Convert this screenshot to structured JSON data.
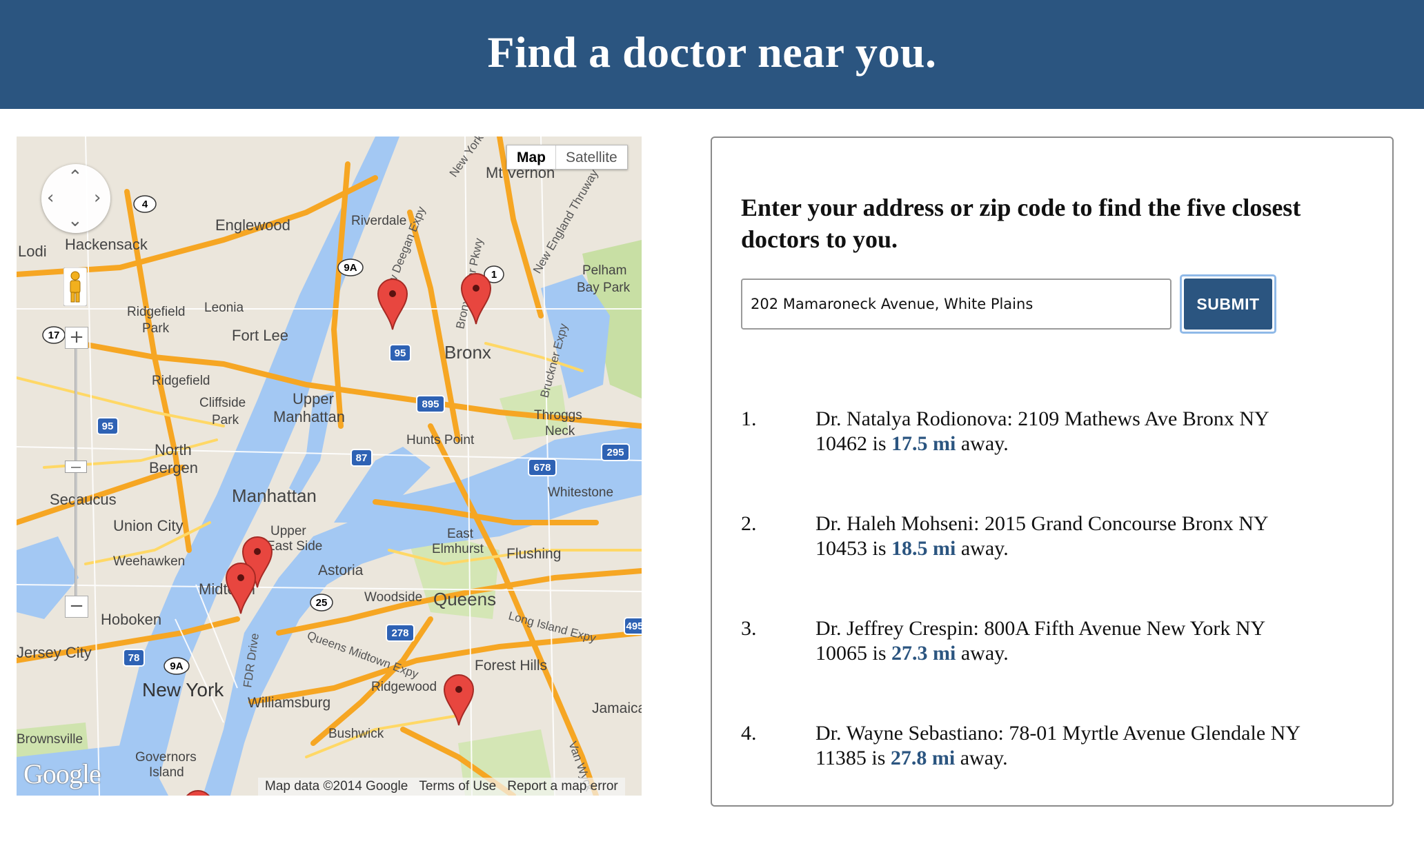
{
  "header": {
    "title": "Find a doctor near you."
  },
  "map": {
    "map_type_buttons": {
      "map": "Map",
      "satellite": "Satellite"
    },
    "footer": {
      "attribution": "Map data ©2014 Google",
      "terms": "Terms of Use",
      "report": "Report a map error"
    },
    "logo": "Google",
    "place_labels": [
      "Mt Vernon",
      "Riverdale",
      "Englewood",
      "Hackensack",
      "Lodi",
      "Pelham Bay Park",
      "Ridgefield Park",
      "Leonia",
      "Fort Lee",
      "Bronx",
      "Ridgefield",
      "Cliffside Park",
      "Upper Manhattan",
      "Throggs Neck",
      "Hunts Point",
      "North Bergen",
      "Secaucus",
      "Manhattan",
      "Whitestone",
      "Union City",
      "Upper East Side",
      "East Elmhurst",
      "Flushing",
      "Weehawken",
      "Astoria",
      "Midtown",
      "Woodside",
      "Queens",
      "Hoboken",
      "Jersey City",
      "Forest Hills",
      "New York",
      "Ridgewood",
      "Williamsburg",
      "Jamaica",
      "Bushwick",
      "Governors Island"
    ],
    "road_labels": [
      "New Deegan Expy",
      "Bronx River Pkwy",
      "New England Thruway",
      "Bruckner Expy",
      "Long Island Expy",
      "Queens Midtown Expy",
      "FDR Drive",
      "Van Wyck",
      "New York"
    ],
    "route_shields": [
      "4",
      "9A",
      "1",
      "95",
      "17",
      "895",
      "95",
      "87",
      "295",
      "678",
      "25",
      "278",
      "78",
      "9A",
      "495"
    ],
    "marker_count": 6
  },
  "search": {
    "prompt": "Enter your address or zip code to find the five closest doctors to you.",
    "address_value": "202 Mamaroneck Avenue, White Plains",
    "submit_label": "SUBMIT"
  },
  "results": [
    {
      "num": "1.",
      "name_address": "Dr. Natalya Rodionova: 2109 Mathews Ave Bronx NY 10462",
      "is": "is",
      "distance": "17.5 mi",
      "away": "away."
    },
    {
      "num": "2.",
      "name_address": "Dr. Haleh Mohseni: 2015 Grand Concourse Bronx NY 10453",
      "is": "is",
      "distance": "18.5 mi",
      "away": "away."
    },
    {
      "num": "3.",
      "name_address": "Dr. Jeffrey Crespin: 800A Fifth Avenue New York NY 10065",
      "is": "is",
      "distance": "27.3 mi",
      "away": "away."
    },
    {
      "num": "4.",
      "name_address": "Dr. Wayne Sebastiano: 78-01 Myrtle Avenue Glendale NY 11385",
      "is": "is",
      "distance": "27.8 mi",
      "away": "away."
    }
  ],
  "colors": {
    "header_bg": "#2b5580",
    "accent": "#2b5580",
    "water": "#a3c8f3",
    "highway": "#f6a623",
    "marker": "#e8463f"
  }
}
